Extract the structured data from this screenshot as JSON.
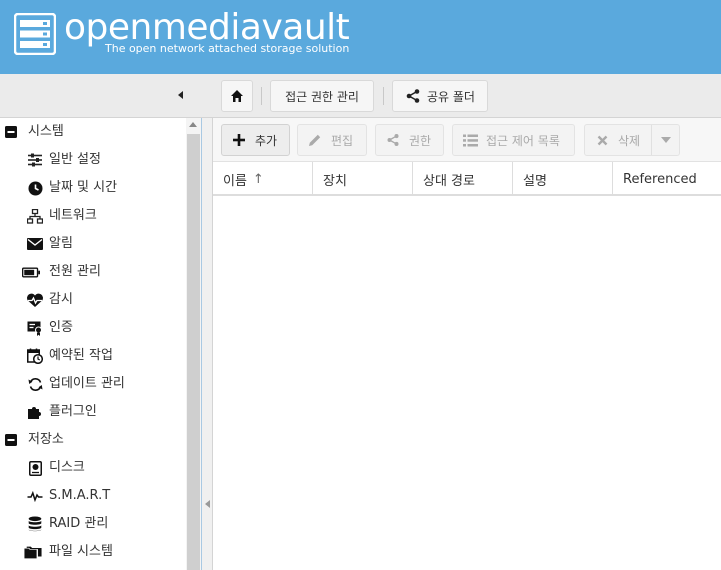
{
  "app": {
    "brand": "openmediavault",
    "tagline": "The open network attached storage solution"
  },
  "breadcrumb": {
    "home_icon": "home-icon",
    "items": [
      "접근 권한 관리",
      "공유 폴더"
    ]
  },
  "nav": {
    "items": [
      {
        "type": "group",
        "label": "시스템",
        "icon": "collapse-minus-icon"
      },
      {
        "type": "item",
        "label": "일반 설정",
        "icon": "sliders-icon"
      },
      {
        "type": "item",
        "label": "날짜 및 시간",
        "icon": "clock-icon"
      },
      {
        "type": "item",
        "label": "네트워크",
        "icon": "network-icon"
      },
      {
        "type": "item",
        "label": "알림",
        "icon": "mail-icon"
      },
      {
        "type": "item",
        "label": "전원 관리",
        "icon": "battery-icon"
      },
      {
        "type": "item",
        "label": "감시",
        "icon": "heartbeat-icon"
      },
      {
        "type": "item",
        "label": "인증",
        "icon": "certificate-icon"
      },
      {
        "type": "item",
        "label": "예약된 작업",
        "icon": "calendar-clock-icon"
      },
      {
        "type": "item",
        "label": "업데이트 관리",
        "icon": "refresh-icon"
      },
      {
        "type": "item",
        "label": "플러그인",
        "icon": "puzzle-icon"
      },
      {
        "type": "group",
        "label": "저장소",
        "icon": "collapse-minus-icon"
      },
      {
        "type": "item",
        "label": "디스크",
        "icon": "hdd-icon"
      },
      {
        "type": "item",
        "label": "S.M.A.R.T",
        "icon": "pulse-icon"
      },
      {
        "type": "item",
        "label": "RAID 관리",
        "icon": "database-icon"
      },
      {
        "type": "item",
        "label": "파일 시스템",
        "icon": "folders-icon"
      }
    ]
  },
  "actions": {
    "add": "추가",
    "edit": "편집",
    "privileges": "권한",
    "acl": "접근 제어 목록",
    "delete": "삭제"
  },
  "grid": {
    "columns": [
      "이름",
      "장치",
      "상대 경로",
      "설명",
      "Referenced"
    ],
    "sort_indicator": "↑"
  },
  "colors": {
    "header": "#5aa9dd",
    "accent": "#a9c9e3"
  }
}
